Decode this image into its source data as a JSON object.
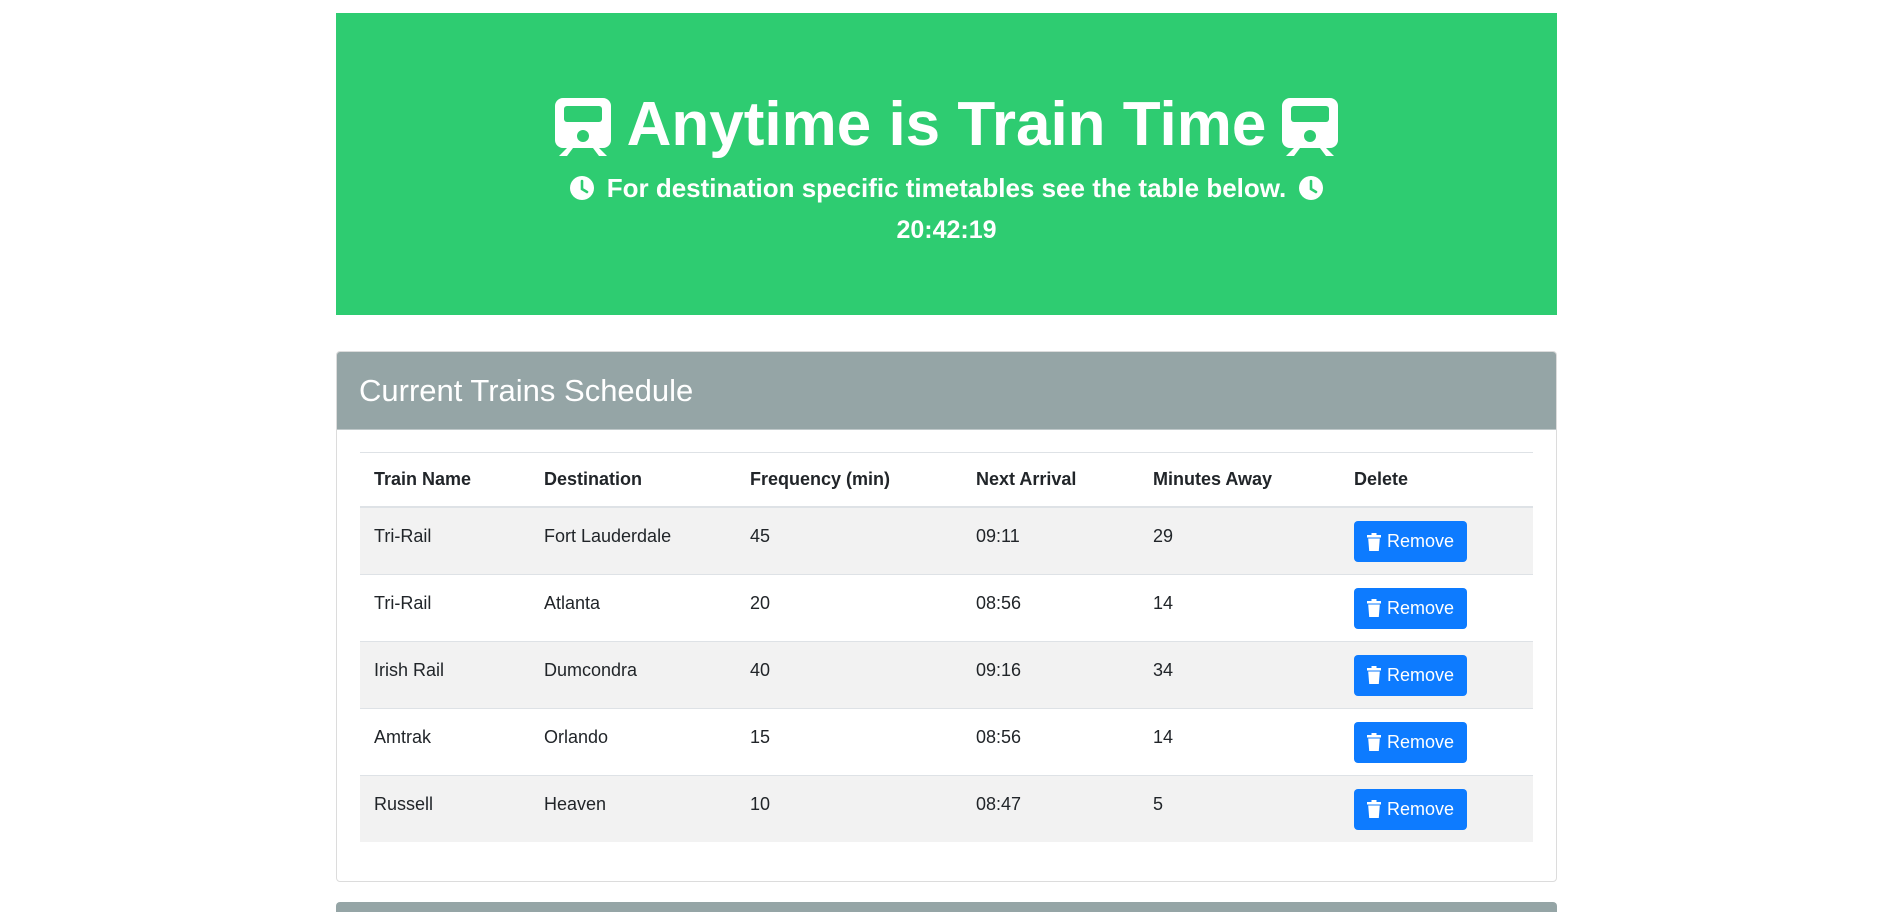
{
  "header": {
    "title": "Anytime is Train Time",
    "subtitle": "For destination specific timetables see the table below.",
    "clock": "20:42:19",
    "background": "#2ecc71"
  },
  "schedule": {
    "title": "Current Trains Schedule",
    "columns": [
      "Train Name",
      "Destination",
      "Frequency (min)",
      "Next Arrival",
      "Minutes Away",
      "Delete"
    ],
    "rows": [
      {
        "name": "Tri-Rail",
        "destination": "Fort Lauderdale",
        "frequency": "45",
        "next": "09:11",
        "away": "29",
        "action": "Remove"
      },
      {
        "name": "Tri-Rail",
        "destination": "Atlanta",
        "frequency": "20",
        "next": "08:56",
        "away": "14",
        "action": "Remove"
      },
      {
        "name": "Irish Rail",
        "destination": "Dumcondra",
        "frequency": "40",
        "next": "09:16",
        "away": "34",
        "action": "Remove"
      },
      {
        "name": "Amtrak",
        "destination": "Orlando",
        "frequency": "15",
        "next": "08:56",
        "away": "14",
        "action": "Remove"
      },
      {
        "name": "Russell",
        "destination": "Heaven",
        "frequency": "10",
        "next": "08:47",
        "away": "5",
        "action": "Remove"
      }
    ]
  },
  "icons": {
    "title": "train-icon",
    "subtitle": "clock-icon",
    "remove": "trash-icon"
  },
  "colors": {
    "header_bg": "#2ecc71",
    "card_header_bg": "#95a5a6",
    "button_bg": "#0d7bff"
  }
}
